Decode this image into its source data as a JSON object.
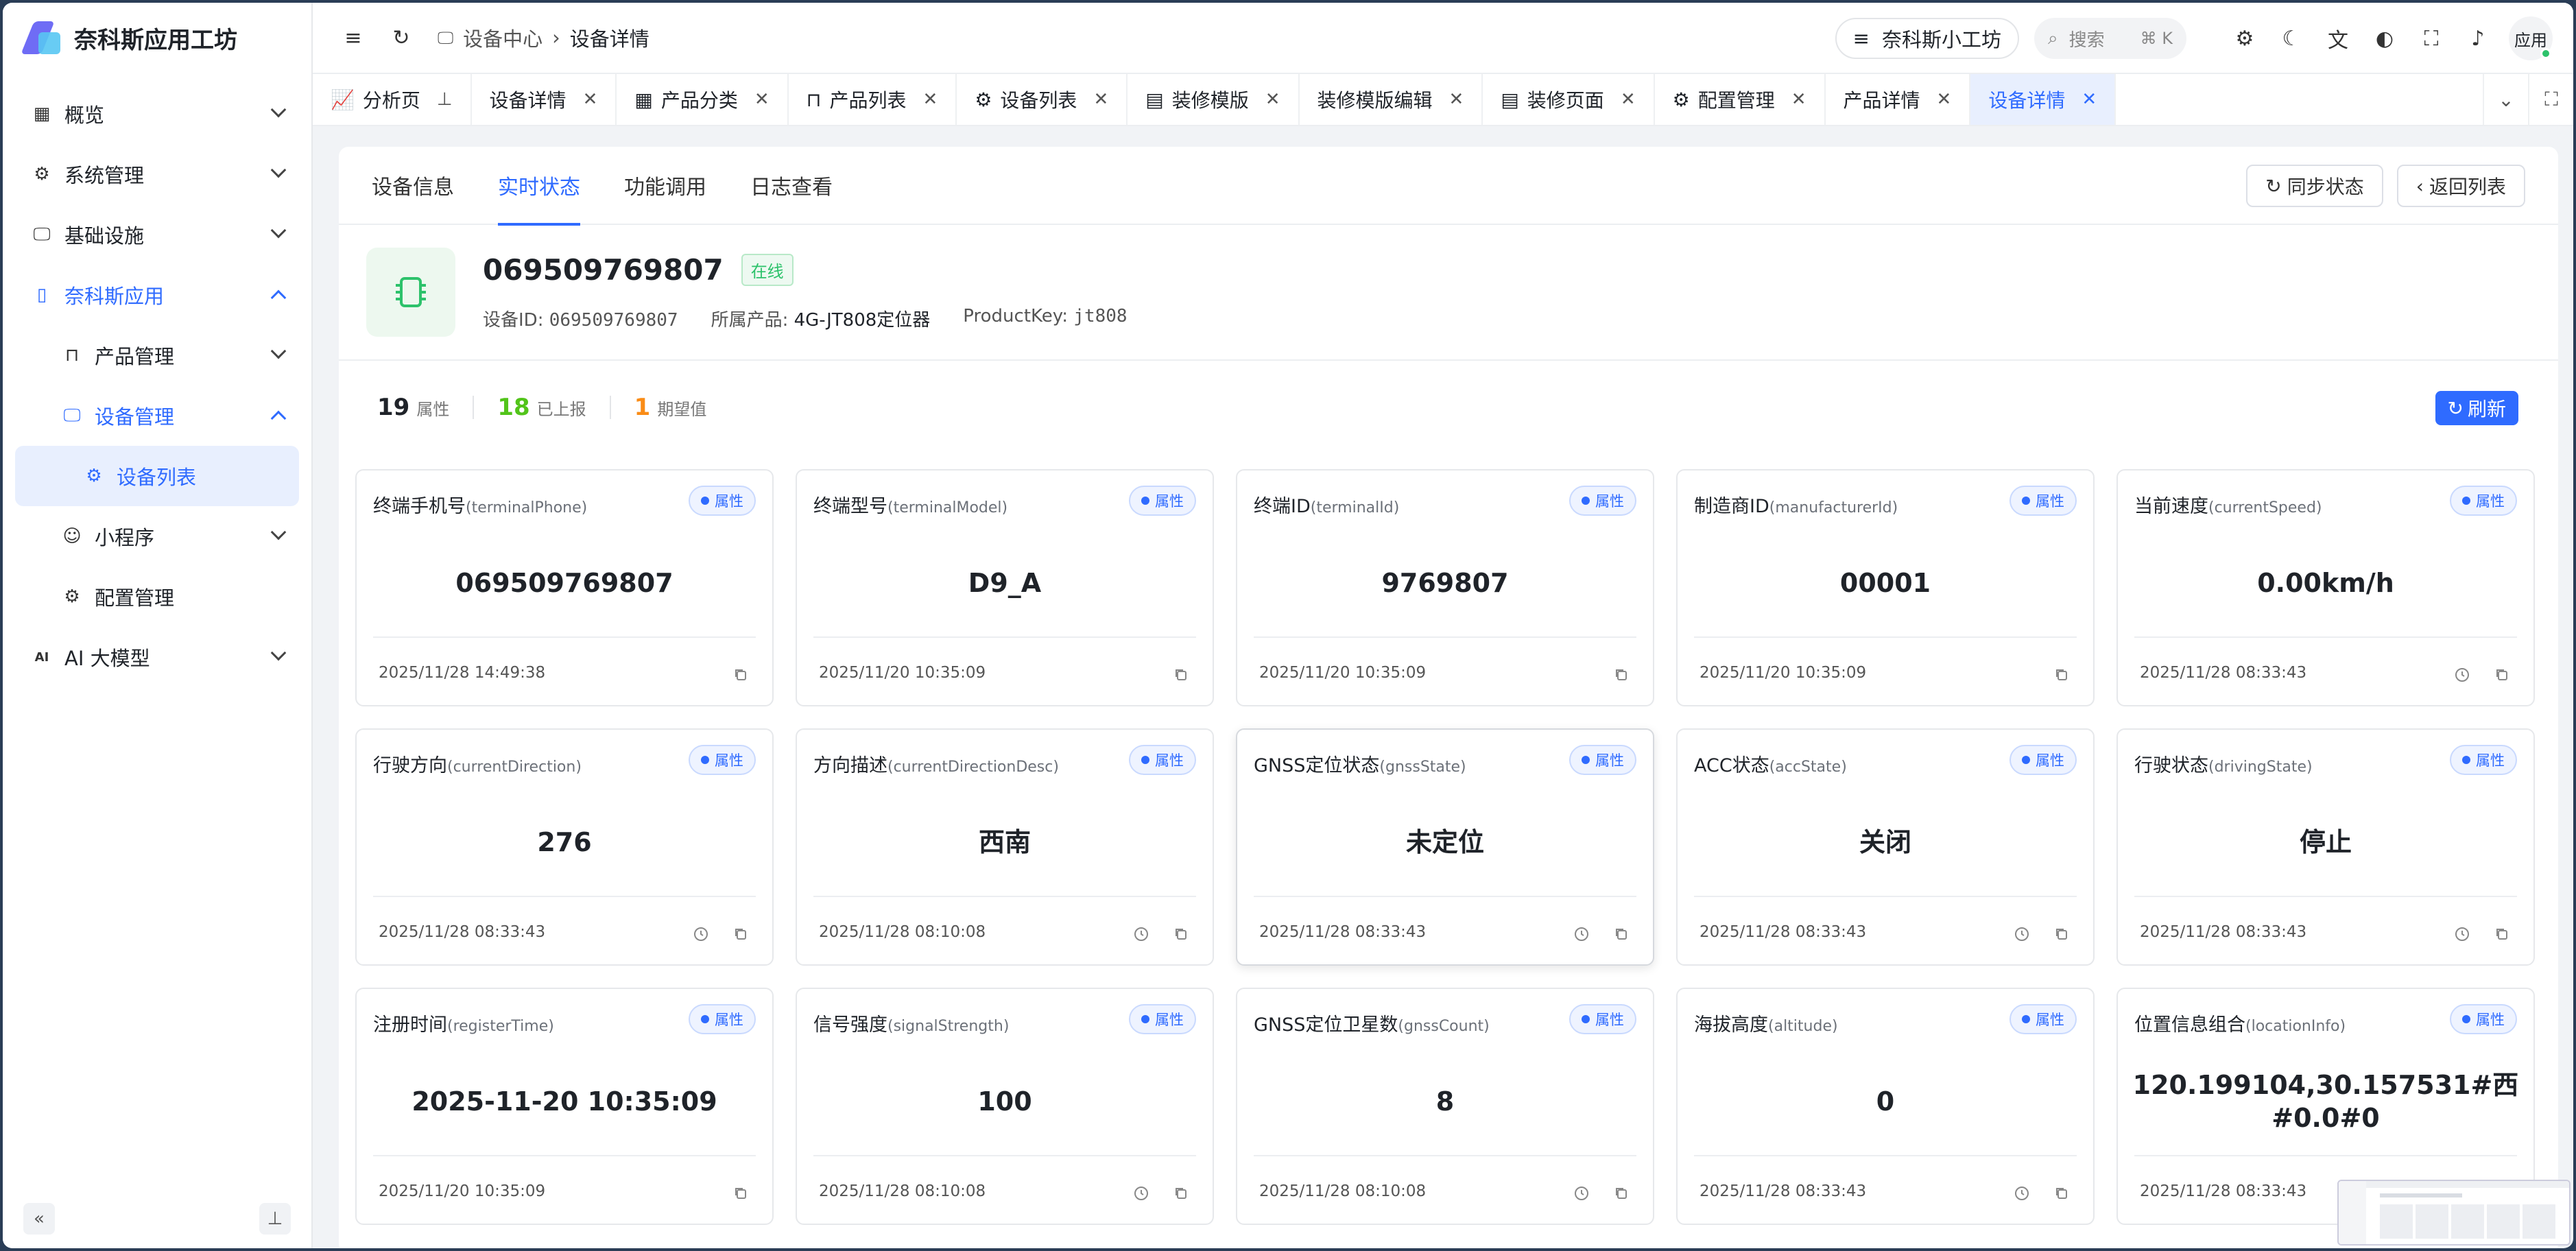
{
  "app": {
    "title": "奈科斯应用工坊"
  },
  "sidebar": {
    "items": [
      {
        "label": "概览"
      },
      {
        "label": "系统管理"
      },
      {
        "label": "基础设施"
      },
      {
        "label": "奈科斯应用"
      },
      {
        "label": "产品管理"
      },
      {
        "label": "设备管理"
      },
      {
        "label": "设备列表"
      },
      {
        "label": "小程序"
      },
      {
        "label": "配置管理"
      },
      {
        "label": "AI 大模型"
      }
    ]
  },
  "header": {
    "breadcrumb": [
      "设备中心",
      "设备详情"
    ],
    "app_switch_label": "奈科斯小工坊",
    "search_placeholder": "搜索",
    "search_shortcut": "⌘ K",
    "user_label": "应用"
  },
  "tabs": [
    {
      "label": "分析页"
    },
    {
      "label": "设备详情"
    },
    {
      "label": "产品分类"
    },
    {
      "label": "产品列表"
    },
    {
      "label": "设备列表"
    },
    {
      "label": "装修模版"
    },
    {
      "label": "装修模版编辑"
    },
    {
      "label": "装修页面"
    },
    {
      "label": "配置管理"
    },
    {
      "label": "产品详情"
    },
    {
      "label": "设备详情"
    }
  ],
  "content": {
    "tabs": [
      "设备信息",
      "实时状态",
      "功能调用",
      "日志查看"
    ],
    "sync_button": "同步状态",
    "back_button": "返回列表",
    "device": {
      "name": "069509769807",
      "status": "在线",
      "id_label": "设备ID:",
      "id_value": "069509769807",
      "product_label": "所属产品:",
      "product_value": "4G-JT808定位器",
      "productkey_label": "ProductKey:",
      "productkey_value": "jt808"
    },
    "stats": {
      "attr_count": "19",
      "attr_label": "属性",
      "reported_count": "18",
      "reported_label": "已上报",
      "expected_count": "1",
      "expected_label": "期望值",
      "refresh_button": "刷新"
    },
    "tag_label": "属性",
    "cards": [
      {
        "name": "终端手机号",
        "key": "(terminalPhone)",
        "value": "069509769807",
        "time": "2025/11/28 14:49:38"
      },
      {
        "name": "终端型号",
        "key": "(terminalModel)",
        "value": "D9_A",
        "time": "2025/11/20 10:35:09"
      },
      {
        "name": "终端ID",
        "key": "(terminalId)",
        "value": "9769807",
        "time": "2025/11/20 10:35:09"
      },
      {
        "name": "制造商ID",
        "key": "(manufacturerId)",
        "value": "00001",
        "time": "2025/11/20 10:35:09"
      },
      {
        "name": "当前速度",
        "key": "(currentSpeed)",
        "value": "0.00km/h",
        "time": "2025/11/28 08:33:43"
      },
      {
        "name": "行驶方向",
        "key": "(currentDirection)",
        "value": "276",
        "time": "2025/11/28 08:33:43"
      },
      {
        "name": "方向描述",
        "key": "(currentDirectionDesc)",
        "value": "西南",
        "time": "2025/11/28 08:10:08"
      },
      {
        "name": "GNSS定位状态",
        "key": "(gnssState)",
        "value": "未定位",
        "time": "2025/11/28 08:33:43"
      },
      {
        "name": "ACC状态",
        "key": "(accState)",
        "value": "关闭",
        "time": "2025/11/28 08:33:43"
      },
      {
        "name": "行驶状态",
        "key": "(drivingState)",
        "value": "停止",
        "time": "2025/11/28 08:33:43"
      },
      {
        "name": "注册时间",
        "key": "(registerTime)",
        "value": "2025-11-20 10:35:09",
        "time": "2025/11/20 10:35:09"
      },
      {
        "name": "信号强度",
        "key": "(signalStrength)",
        "value": "100",
        "time": "2025/11/28 08:10:08"
      },
      {
        "name": "GNSS定位卫星数",
        "key": "(gnssCount)",
        "value": "8",
        "time": "2025/11/28 08:10:08"
      },
      {
        "name": "海拔高度",
        "key": "(altitude)",
        "value": "0",
        "time": "2025/11/28 08:33:43"
      },
      {
        "name": "位置信息组合",
        "key": "(locationInfo)",
        "value": "120.199104,30.157531#西#0.0#0",
        "time": "2025/11/28 08:33:43"
      }
    ]
  },
  "colors": {
    "accent": "#2f6bff",
    "online": "#2dc26b",
    "reported": "#52c41a",
    "expected": "#fa8c16"
  }
}
